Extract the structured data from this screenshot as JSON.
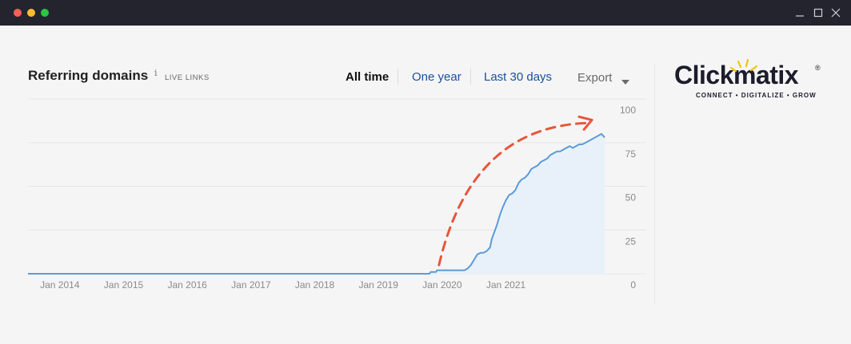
{
  "window": {
    "controls": [
      "close",
      "minimize",
      "maximize"
    ],
    "right_icons": [
      "minimize-icon",
      "maximize-icon",
      "close-icon"
    ]
  },
  "header": {
    "title": "Referring domains",
    "info_glyph": "i",
    "subtitle": "LIVE LINKS",
    "tabs": [
      {
        "label": "All time",
        "active": true
      },
      {
        "label": "One year",
        "active": false
      },
      {
        "label": "Last 30 days",
        "active": false
      }
    ],
    "export_label": "Export"
  },
  "logo": {
    "text": "Clickmatix",
    "registered": "®",
    "tagline": "CONNECT • DIGITALIZE • GROW",
    "colors": {
      "text": "#1c1c2b",
      "accent": "#f5c400"
    }
  },
  "colors": {
    "line": "#5b9bd8",
    "area": "#e8f1fa",
    "arrow": "#e8553a",
    "grid": "#e6e6e6",
    "tab_link": "#1a4fa0"
  },
  "chart_data": {
    "type": "area",
    "title": "Referring domains",
    "xlabel": "",
    "ylabel": "",
    "x_ticks": [
      "Jan 2014",
      "Jan 2015",
      "Jan 2016",
      "Jan 2017",
      "Jan 2018",
      "Jan 2019",
      "Jan 2020",
      "Jan 2021"
    ],
    "y_ticks": [
      0,
      25,
      50,
      75,
      100
    ],
    "ylim": [
      0,
      100
    ],
    "xlim": [
      2013.5,
      2022.6
    ],
    "grid": true,
    "series": [
      {
        "x": [
          2013.5,
          2019.8,
          2019.82,
          2019.9,
          2019.92,
          2020.35,
          2020.4,
          2020.45,
          2020.5,
          2020.55,
          2020.6,
          2020.65,
          2020.7,
          2020.75,
          2020.78,
          2020.82,
          2020.86,
          2020.9,
          2020.95,
          2021.0,
          2021.05,
          2021.1,
          2021.15,
          2021.2,
          2021.25,
          2021.3,
          2021.35,
          2021.4,
          2021.45,
          2021.5,
          2021.55,
          2021.6,
          2021.65,
          2021.7,
          2021.75,
          2021.8,
          2021.85,
          2021.9,
          2021.95,
          2022.0,
          2022.05,
          2022.1,
          2022.15,
          2022.2,
          2022.25,
          2022.3,
          2022.35,
          2022.4,
          2022.45,
          2022.5,
          2022.55
        ],
        "values": [
          0,
          0,
          1,
          1,
          2,
          2,
          3,
          5,
          8,
          11,
          12,
          12,
          13,
          15,
          20,
          24,
          28,
          33,
          38,
          42,
          45,
          46,
          48,
          52,
          54,
          55,
          57,
          60,
          61,
          62,
          64,
          65,
          66,
          68,
          69,
          70,
          70,
          71,
          72,
          73,
          72,
          73,
          74,
          74,
          75,
          76,
          77,
          78,
          79,
          80,
          78
        ]
      }
    ],
    "annotations": [
      {
        "type": "dashed-arrow",
        "color": "#e8553a",
        "description": "trend arrow"
      }
    ]
  }
}
